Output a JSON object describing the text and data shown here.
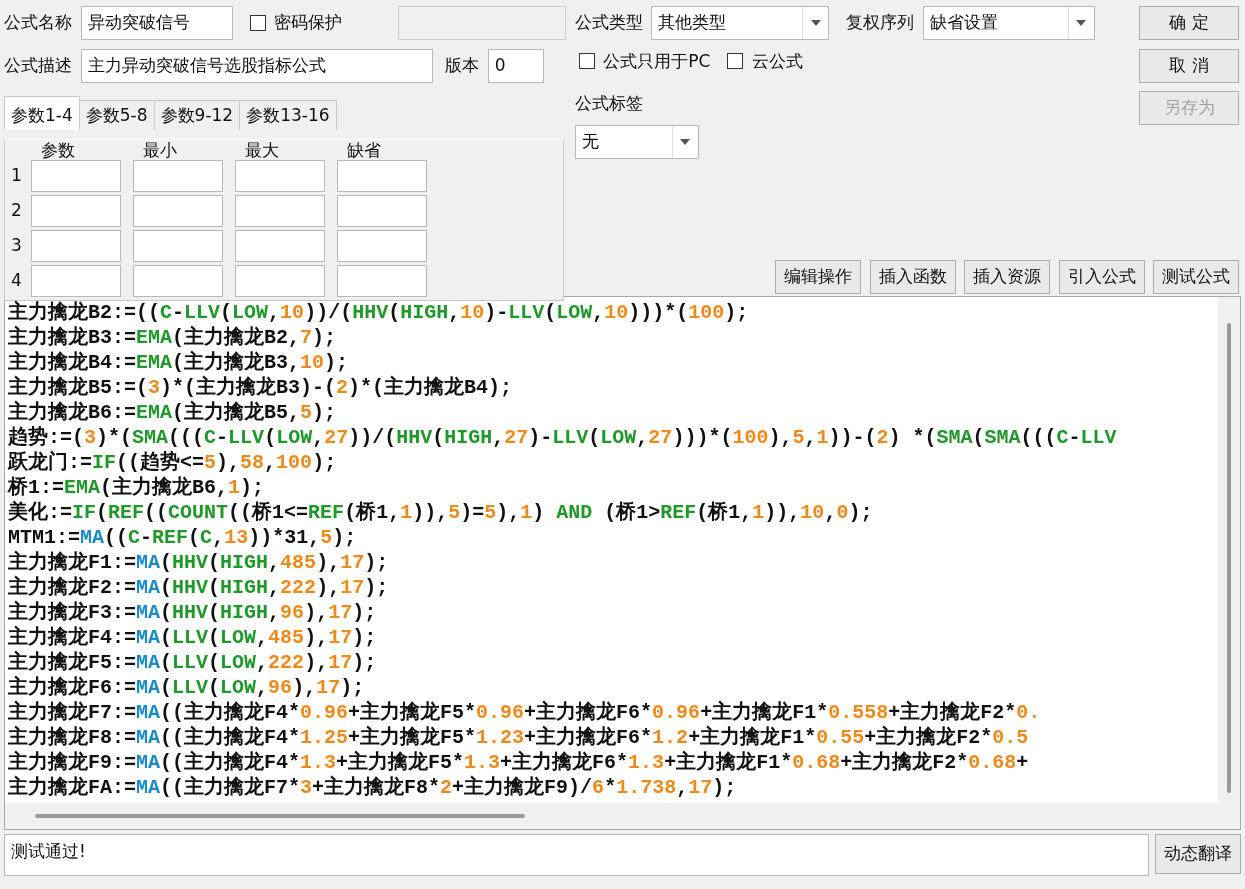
{
  "form": {
    "name_label": "公式名称",
    "name_value": "异动突破信号",
    "password": {
      "label": "密码保护",
      "checked": false
    },
    "desc_label": "公式描述",
    "desc_value": "主力异动突破信号选股指标公式",
    "version_label": "版本",
    "version_value": "0",
    "type_label": "公式类型",
    "type_value": "其他类型",
    "rights_label": "复权序列",
    "rights_value": "缺省设置",
    "options": [
      {
        "label": "公式只用于PC",
        "checked": false
      },
      {
        "label": "云公式",
        "checked": false
      }
    ],
    "tag_label": "公式标签",
    "tag_value": "无"
  },
  "side_buttons": [
    {
      "label": "确 定",
      "disabled": false
    },
    {
      "label": "取 消",
      "disabled": false
    },
    {
      "label": "另存为",
      "disabled": true
    }
  ],
  "tabs": [
    {
      "label": "参数1-4",
      "selected": true
    },
    {
      "label": "参数5-8",
      "selected": false
    },
    {
      "label": "参数9-12",
      "selected": false
    },
    {
      "label": "参数13-16",
      "selected": false
    }
  ],
  "params": {
    "columns": [
      "参数",
      "最小",
      "最大",
      "缺省"
    ],
    "rows": [
      "1",
      "2",
      "3",
      "4"
    ]
  },
  "tool_buttons": [
    "编辑操作",
    "插入函数",
    "插入资源",
    "引入公式",
    "测试公式"
  ],
  "code_lines": [
    [
      {
        "kind": "text",
        "text": "主力擒龙B2:=(("
      },
      {
        "kind": "func",
        "text": "C"
      },
      {
        "kind": "text",
        "text": "-"
      },
      {
        "kind": "func",
        "text": "LLV"
      },
      {
        "kind": "text",
        "text": "("
      },
      {
        "kind": "func",
        "text": "LOW"
      },
      {
        "kind": "text",
        "text": ","
      },
      {
        "kind": "num",
        "text": "10"
      },
      {
        "kind": "text",
        "text": "))/("
      },
      {
        "kind": "func",
        "text": "HHV"
      },
      {
        "kind": "text",
        "text": "("
      },
      {
        "kind": "func",
        "text": "HIGH"
      },
      {
        "kind": "text",
        "text": ","
      },
      {
        "kind": "num",
        "text": "10"
      },
      {
        "kind": "text",
        "text": ")-"
      },
      {
        "kind": "func",
        "text": "LLV"
      },
      {
        "kind": "text",
        "text": "("
      },
      {
        "kind": "func",
        "text": "LOW"
      },
      {
        "kind": "text",
        "text": ","
      },
      {
        "kind": "num",
        "text": "10"
      },
      {
        "kind": "text",
        "text": ")))*("
      },
      {
        "kind": "num",
        "text": "100"
      },
      {
        "kind": "text",
        "text": ");"
      }
    ],
    [
      {
        "kind": "text",
        "text": "主力擒龙B3:="
      },
      {
        "kind": "func",
        "text": "EMA"
      },
      {
        "kind": "text",
        "text": "(主力擒龙B2,"
      },
      {
        "kind": "num",
        "text": "7"
      },
      {
        "kind": "text",
        "text": ");"
      }
    ],
    [
      {
        "kind": "text",
        "text": "主力擒龙B4:="
      },
      {
        "kind": "func",
        "text": "EMA"
      },
      {
        "kind": "text",
        "text": "(主力擒龙B3,"
      },
      {
        "kind": "num",
        "text": "10"
      },
      {
        "kind": "text",
        "text": ");"
      }
    ],
    [
      {
        "kind": "text",
        "text": "主力擒龙B5:=("
      },
      {
        "kind": "num",
        "text": "3"
      },
      {
        "kind": "text",
        "text": ")*(主力擒龙B3)-("
      },
      {
        "kind": "num",
        "text": "2"
      },
      {
        "kind": "text",
        "text": ")*(主力擒龙B4);"
      }
    ],
    [
      {
        "kind": "text",
        "text": "主力擒龙B6:="
      },
      {
        "kind": "func",
        "text": "EMA"
      },
      {
        "kind": "text",
        "text": "(主力擒龙B5,"
      },
      {
        "kind": "num",
        "text": "5"
      },
      {
        "kind": "text",
        "text": ");"
      }
    ],
    [
      {
        "kind": "text",
        "text": "趋势:=("
      },
      {
        "kind": "num",
        "text": "3"
      },
      {
        "kind": "text",
        "text": ")*("
      },
      {
        "kind": "func",
        "text": "SMA"
      },
      {
        "kind": "text",
        "text": "((("
      },
      {
        "kind": "func",
        "text": "C"
      },
      {
        "kind": "text",
        "text": "-"
      },
      {
        "kind": "func",
        "text": "LLV"
      },
      {
        "kind": "text",
        "text": "("
      },
      {
        "kind": "func",
        "text": "LOW"
      },
      {
        "kind": "text",
        "text": ","
      },
      {
        "kind": "num",
        "text": "27"
      },
      {
        "kind": "text",
        "text": "))/("
      },
      {
        "kind": "func",
        "text": "HHV"
      },
      {
        "kind": "text",
        "text": "("
      },
      {
        "kind": "func",
        "text": "HIGH"
      },
      {
        "kind": "text",
        "text": ","
      },
      {
        "kind": "num",
        "text": "27"
      },
      {
        "kind": "text",
        "text": ")-"
      },
      {
        "kind": "func",
        "text": "LLV"
      },
      {
        "kind": "text",
        "text": "("
      },
      {
        "kind": "func",
        "text": "LOW"
      },
      {
        "kind": "text",
        "text": ","
      },
      {
        "kind": "num",
        "text": "27"
      },
      {
        "kind": "text",
        "text": ")))*("
      },
      {
        "kind": "num",
        "text": "100"
      },
      {
        "kind": "text",
        "text": "),"
      },
      {
        "kind": "num",
        "text": "5"
      },
      {
        "kind": "text",
        "text": ","
      },
      {
        "kind": "num",
        "text": "1"
      },
      {
        "kind": "text",
        "text": "))-("
      },
      {
        "kind": "num",
        "text": "2"
      },
      {
        "kind": "text",
        "text": ") *("
      },
      {
        "kind": "func",
        "text": "SMA"
      },
      {
        "kind": "text",
        "text": "("
      },
      {
        "kind": "func",
        "text": "SMA"
      },
      {
        "kind": "text",
        "text": "((("
      },
      {
        "kind": "func",
        "text": "C"
      },
      {
        "kind": "text",
        "text": "-"
      },
      {
        "kind": "func",
        "text": "LLV"
      }
    ],
    [
      {
        "kind": "text",
        "text": "跃龙门:="
      },
      {
        "kind": "func",
        "text": "IF"
      },
      {
        "kind": "text",
        "text": "((趋势<="
      },
      {
        "kind": "num",
        "text": "5"
      },
      {
        "kind": "text",
        "text": "),"
      },
      {
        "kind": "num",
        "text": "58"
      },
      {
        "kind": "text",
        "text": ","
      },
      {
        "kind": "num",
        "text": "100"
      },
      {
        "kind": "text",
        "text": ");"
      }
    ],
    [
      {
        "kind": "text",
        "text": "桥1:="
      },
      {
        "kind": "func",
        "text": "EMA"
      },
      {
        "kind": "text",
        "text": "(主力擒龙B6,"
      },
      {
        "kind": "num",
        "text": "1"
      },
      {
        "kind": "text",
        "text": ");"
      }
    ],
    [
      {
        "kind": "text",
        "text": "美化:="
      },
      {
        "kind": "func",
        "text": "IF"
      },
      {
        "kind": "text",
        "text": "("
      },
      {
        "kind": "func",
        "text": "REF"
      },
      {
        "kind": "text",
        "text": "(("
      },
      {
        "kind": "func",
        "text": "COUNT"
      },
      {
        "kind": "text",
        "text": "((桥1<="
      },
      {
        "kind": "func",
        "text": "REF"
      },
      {
        "kind": "text",
        "text": "(桥1,"
      },
      {
        "kind": "num",
        "text": "1"
      },
      {
        "kind": "text",
        "text": ")),"
      },
      {
        "kind": "num",
        "text": "5"
      },
      {
        "kind": "text",
        "text": ")="
      },
      {
        "kind": "num",
        "text": "5"
      },
      {
        "kind": "text",
        "text": "),"
      },
      {
        "kind": "num",
        "text": "1"
      },
      {
        "kind": "text",
        "text": ") "
      },
      {
        "kind": "func",
        "text": "AND"
      },
      {
        "kind": "text",
        "text": " (桥1>"
      },
      {
        "kind": "func",
        "text": "REF"
      },
      {
        "kind": "text",
        "text": "(桥1,"
      },
      {
        "kind": "num",
        "text": "1"
      },
      {
        "kind": "text",
        "text": ")),"
      },
      {
        "kind": "num",
        "text": "10"
      },
      {
        "kind": "text",
        "text": ","
      },
      {
        "kind": "num",
        "text": "0"
      },
      {
        "kind": "text",
        "text": ");"
      }
    ],
    [
      {
        "kind": "text",
        "text": "MTM1:="
      },
      {
        "kind": "ma",
        "text": "MA"
      },
      {
        "kind": "text",
        "text": "(("
      },
      {
        "kind": "func",
        "text": "C"
      },
      {
        "kind": "text",
        "text": "-"
      },
      {
        "kind": "func",
        "text": "REF"
      },
      {
        "kind": "text",
        "text": "("
      },
      {
        "kind": "func",
        "text": "C"
      },
      {
        "kind": "text",
        "text": ","
      },
      {
        "kind": "num",
        "text": "13"
      },
      {
        "kind": "text",
        "text": "))*31,"
      },
      {
        "kind": "num",
        "text": "5"
      },
      {
        "kind": "text",
        "text": ");"
      }
    ],
    [
      {
        "kind": "text",
        "text": "主力擒龙F1:="
      },
      {
        "kind": "ma",
        "text": "MA"
      },
      {
        "kind": "text",
        "text": "("
      },
      {
        "kind": "func",
        "text": "HHV"
      },
      {
        "kind": "text",
        "text": "("
      },
      {
        "kind": "func",
        "text": "HIGH"
      },
      {
        "kind": "text",
        "text": ","
      },
      {
        "kind": "num",
        "text": "485"
      },
      {
        "kind": "text",
        "text": "),"
      },
      {
        "kind": "num",
        "text": "17"
      },
      {
        "kind": "text",
        "text": ");"
      }
    ],
    [
      {
        "kind": "text",
        "text": "主力擒龙F2:="
      },
      {
        "kind": "ma",
        "text": "MA"
      },
      {
        "kind": "text",
        "text": "("
      },
      {
        "kind": "func",
        "text": "HHV"
      },
      {
        "kind": "text",
        "text": "("
      },
      {
        "kind": "func",
        "text": "HIGH"
      },
      {
        "kind": "text",
        "text": ","
      },
      {
        "kind": "num",
        "text": "222"
      },
      {
        "kind": "text",
        "text": "),"
      },
      {
        "kind": "num",
        "text": "17"
      },
      {
        "kind": "text",
        "text": ");"
      }
    ],
    [
      {
        "kind": "text",
        "text": "主力擒龙F3:="
      },
      {
        "kind": "ma",
        "text": "MA"
      },
      {
        "kind": "text",
        "text": "("
      },
      {
        "kind": "func",
        "text": "HHV"
      },
      {
        "kind": "text",
        "text": "("
      },
      {
        "kind": "func",
        "text": "HIGH"
      },
      {
        "kind": "text",
        "text": ","
      },
      {
        "kind": "num",
        "text": "96"
      },
      {
        "kind": "text",
        "text": "),"
      },
      {
        "kind": "num",
        "text": "17"
      },
      {
        "kind": "text",
        "text": ");"
      }
    ],
    [
      {
        "kind": "text",
        "text": "主力擒龙F4:="
      },
      {
        "kind": "ma",
        "text": "MA"
      },
      {
        "kind": "text",
        "text": "("
      },
      {
        "kind": "func",
        "text": "LLV"
      },
      {
        "kind": "text",
        "text": "("
      },
      {
        "kind": "func",
        "text": "LOW"
      },
      {
        "kind": "text",
        "text": ","
      },
      {
        "kind": "num",
        "text": "485"
      },
      {
        "kind": "text",
        "text": "),"
      },
      {
        "kind": "num",
        "text": "17"
      },
      {
        "kind": "text",
        "text": ");"
      }
    ],
    [
      {
        "kind": "text",
        "text": "主力擒龙F5:="
      },
      {
        "kind": "ma",
        "text": "MA"
      },
      {
        "kind": "text",
        "text": "("
      },
      {
        "kind": "func",
        "text": "LLV"
      },
      {
        "kind": "text",
        "text": "("
      },
      {
        "kind": "func",
        "text": "LOW"
      },
      {
        "kind": "text",
        "text": ","
      },
      {
        "kind": "num",
        "text": "222"
      },
      {
        "kind": "text",
        "text": "),"
      },
      {
        "kind": "num",
        "text": "17"
      },
      {
        "kind": "text",
        "text": ");"
      }
    ],
    [
      {
        "kind": "text",
        "text": "主力擒龙F6:="
      },
      {
        "kind": "ma",
        "text": "MA"
      },
      {
        "kind": "text",
        "text": "("
      },
      {
        "kind": "func",
        "text": "LLV"
      },
      {
        "kind": "text",
        "text": "("
      },
      {
        "kind": "func",
        "text": "LOW"
      },
      {
        "kind": "text",
        "text": ","
      },
      {
        "kind": "num",
        "text": "96"
      },
      {
        "kind": "text",
        "text": "),"
      },
      {
        "kind": "num",
        "text": "17"
      },
      {
        "kind": "text",
        "text": ");"
      }
    ],
    [
      {
        "kind": "text",
        "text": "主力擒龙F7:="
      },
      {
        "kind": "ma",
        "text": "MA"
      },
      {
        "kind": "text",
        "text": "((主力擒龙F4*"
      },
      {
        "kind": "num",
        "text": "0.96"
      },
      {
        "kind": "text",
        "text": "+主力擒龙F5*"
      },
      {
        "kind": "num",
        "text": "0.96"
      },
      {
        "kind": "text",
        "text": "+主力擒龙F6*"
      },
      {
        "kind": "num",
        "text": "0.96"
      },
      {
        "kind": "text",
        "text": "+主力擒龙F1*"
      },
      {
        "kind": "num",
        "text": "0.558"
      },
      {
        "kind": "text",
        "text": "+主力擒龙F2*"
      },
      {
        "kind": "num",
        "text": "0."
      }
    ],
    [
      {
        "kind": "text",
        "text": "主力擒龙F8:="
      },
      {
        "kind": "ma",
        "text": "MA"
      },
      {
        "kind": "text",
        "text": "((主力擒龙F4*"
      },
      {
        "kind": "num",
        "text": "1.25"
      },
      {
        "kind": "text",
        "text": "+主力擒龙F5*"
      },
      {
        "kind": "num",
        "text": "1.23"
      },
      {
        "kind": "text",
        "text": "+主力擒龙F6*"
      },
      {
        "kind": "num",
        "text": "1.2"
      },
      {
        "kind": "text",
        "text": "+主力擒龙F1*"
      },
      {
        "kind": "num",
        "text": "0.55"
      },
      {
        "kind": "text",
        "text": "+主力擒龙F2*"
      },
      {
        "kind": "num",
        "text": "0.5"
      }
    ],
    [
      {
        "kind": "text",
        "text": "主力擒龙F9:="
      },
      {
        "kind": "ma",
        "text": "MA"
      },
      {
        "kind": "text",
        "text": "((主力擒龙F4*"
      },
      {
        "kind": "num",
        "text": "1.3"
      },
      {
        "kind": "text",
        "text": "+主力擒龙F5*"
      },
      {
        "kind": "num",
        "text": "1.3"
      },
      {
        "kind": "text",
        "text": "+主力擒龙F6*"
      },
      {
        "kind": "num",
        "text": "1.3"
      },
      {
        "kind": "text",
        "text": "+主力擒龙F1*"
      },
      {
        "kind": "num",
        "text": "0.68"
      },
      {
        "kind": "text",
        "text": "+主力擒龙F2*"
      },
      {
        "kind": "num",
        "text": "0.68"
      },
      {
        "kind": "text",
        "text": "+"
      }
    ],
    [
      {
        "kind": "text",
        "text": "主力擒龙FA:="
      },
      {
        "kind": "ma",
        "text": "MA"
      },
      {
        "kind": "text",
        "text": "((主力擒龙F7*"
      },
      {
        "kind": "num",
        "text": "3"
      },
      {
        "kind": "text",
        "text": "+主力擒龙F8*"
      },
      {
        "kind": "num",
        "text": "2"
      },
      {
        "kind": "text",
        "text": "+主力擒龙F9)/"
      },
      {
        "kind": "num",
        "text": "6"
      },
      {
        "kind": "text",
        "text": "*"
      },
      {
        "kind": "num",
        "text": "1.738"
      },
      {
        "kind": "text",
        "text": ","
      },
      {
        "kind": "num",
        "text": "17"
      },
      {
        "kind": "text",
        "text": ");"
      }
    ]
  ],
  "status": {
    "message": "测试通过!",
    "button": "动态翻译"
  }
}
